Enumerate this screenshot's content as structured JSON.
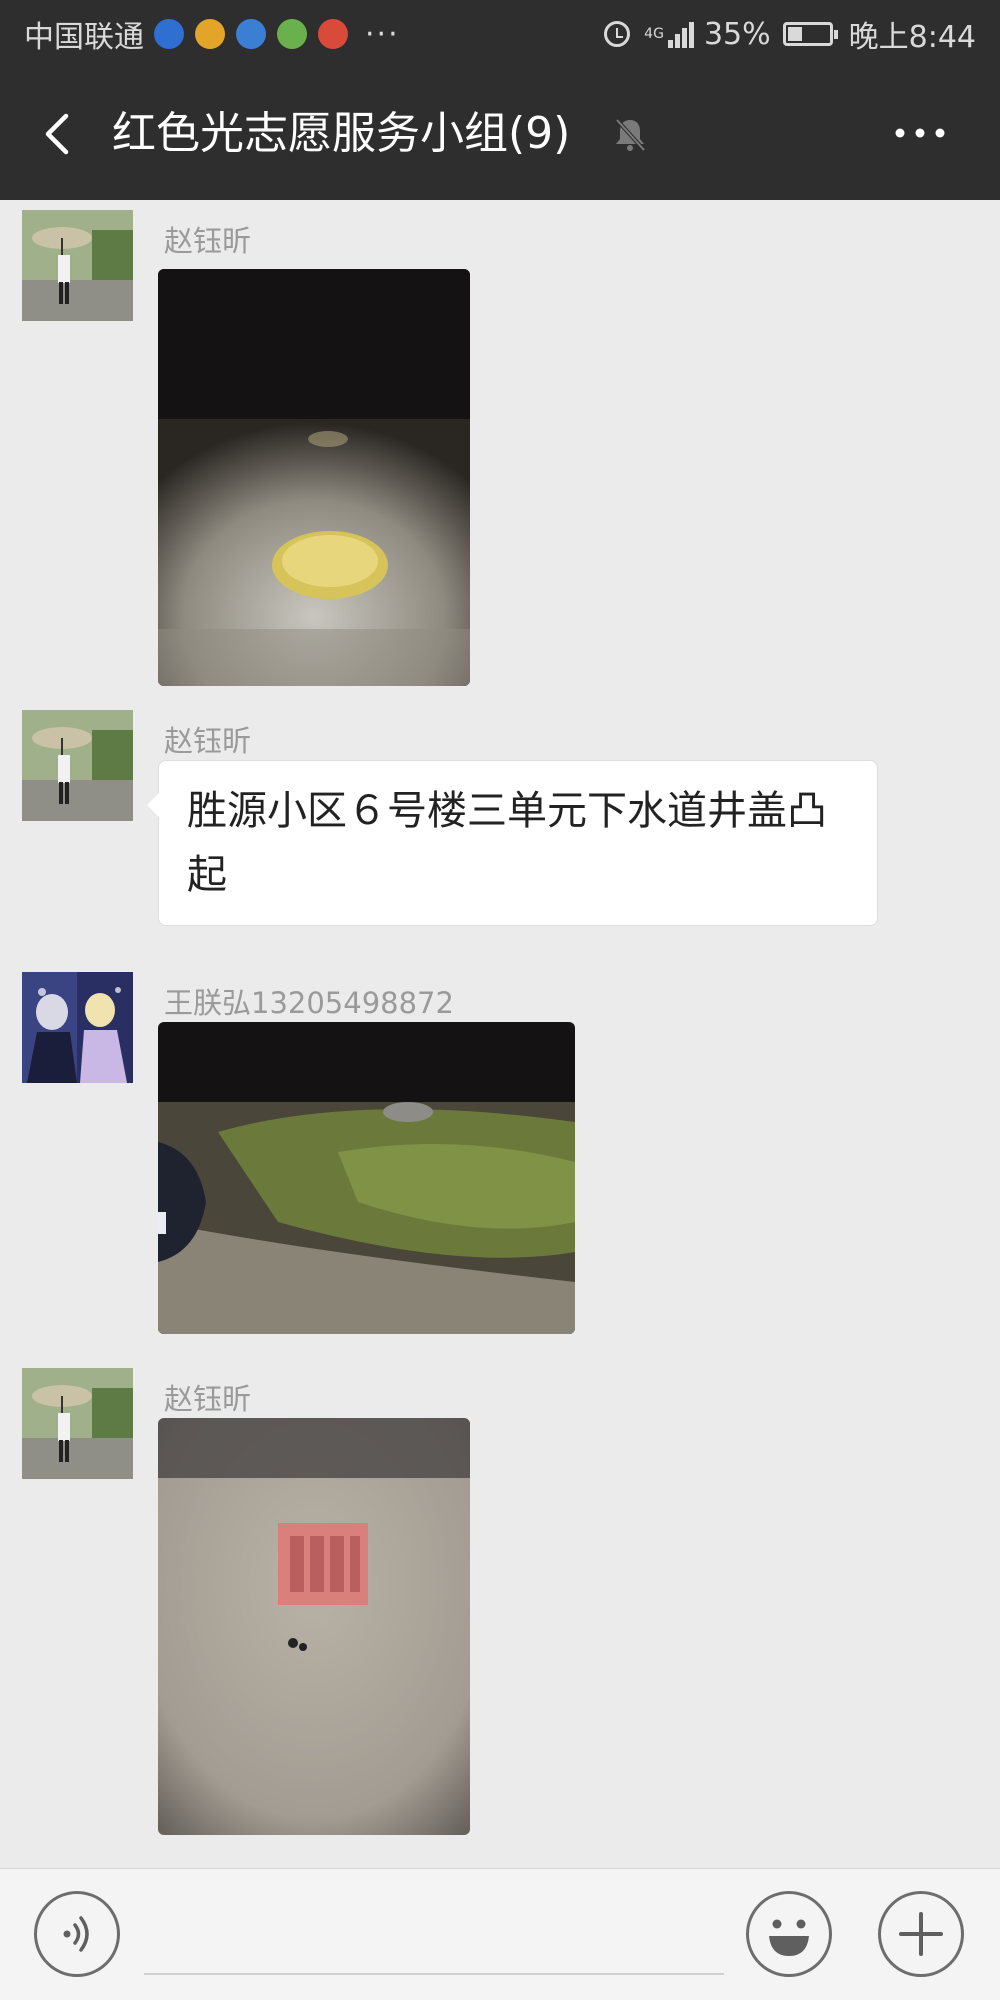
{
  "status_bar": {
    "carrier": "中国联通",
    "more": "···",
    "network": "4G",
    "battery": "35%",
    "battery_level": 0.35,
    "time": "晚上8:44"
  },
  "header": {
    "title": "红色光志愿服务小组(9)"
  },
  "messages": [
    {
      "sender": "赵钰昕",
      "type": "image"
    },
    {
      "sender": "赵钰昕",
      "type": "text",
      "text": "胜源小区６号楼三单元下水道井盖凸起"
    },
    {
      "sender": "王朕弘13205498872",
      "type": "image"
    },
    {
      "sender": "赵钰昕",
      "type": "image"
    }
  ],
  "input": {
    "placeholder": ""
  }
}
